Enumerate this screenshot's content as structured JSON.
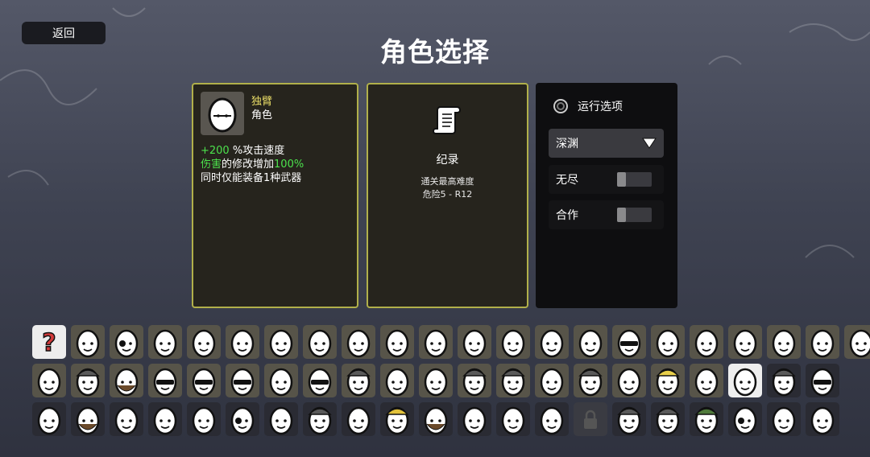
{
  "header": {
    "back_label": "返回",
    "title": "角色选择"
  },
  "character": {
    "name": "独臂",
    "type": "角色",
    "stat1_value": "+200",
    "stat1_text": " %攻击速度",
    "stat2_highlight": "伤害",
    "stat2_text": "的修改增加",
    "stat2_value": "100%",
    "stat3_text": "同时仅能装备1种武器"
  },
  "record": {
    "title": "纪录",
    "subtitle": "通关最高难度",
    "value": "危险5 - R12"
  },
  "options": {
    "title": "运行选项",
    "difficulty_selected": "深渊",
    "endless_label": "无尽",
    "coop_label": "合作"
  },
  "colors": {
    "accent_border": "#b1b04a",
    "name_yellow": "#e9dd67",
    "stat_green": "#4ce24c"
  },
  "roster": {
    "rows": [
      [
        "random",
        "smile",
        "eyepatch",
        "smile",
        "grin",
        "monocle",
        "robot",
        "smile",
        "angry",
        "tired",
        "bandit",
        "mischief",
        "shout",
        "smile",
        "pout",
        "glasses",
        "huge-eye",
        "smile",
        "scar",
        "bunny",
        "wink",
        "tongue"
      ],
      [
        "smile",
        "helmet",
        "beard",
        "sunglasses",
        "ninja",
        "sunglasses",
        "panda",
        "goggles",
        "knight",
        "vampire",
        "blush",
        "wizard",
        "cowboy",
        "crow",
        "hat",
        "cracked",
        "king",
        "zombie",
        "one-armed",
        "cap",
        "visor"
      ],
      [
        "smile",
        "mustache",
        "sleepy",
        "bird",
        "scarf",
        "eyepatch",
        "lipstick",
        "rounded-hat",
        "bald",
        "miner",
        "stubble",
        "gas-mask",
        "smile",
        "old-man",
        "locked",
        "gangster",
        "knight-helm",
        "green-cap",
        "pirate",
        "smile",
        "smirk"
      ]
    ],
    "selected": "one-armed",
    "locked_icon": "padlock-icon",
    "random_icon": "question-mark-icon"
  }
}
